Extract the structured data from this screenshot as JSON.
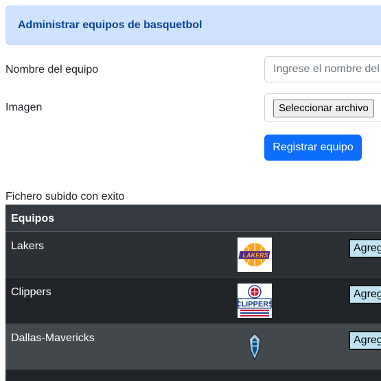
{
  "header": {
    "title": "Administrar equipos de basquetbol"
  },
  "form": {
    "name_label": "Nombre del equipo",
    "name_placeholder": "Ingrese el nombre del equipo",
    "name_value": "",
    "image_label": "Imagen",
    "file_button_label": "Seleccionar archivo",
    "submit_label": "Registrar equipo"
  },
  "status": {
    "message": "Fichero subido con exito"
  },
  "table": {
    "header": "Equipos",
    "rows": [
      {
        "name": "Lakers",
        "logo_icon": "lakers-logo-icon",
        "action_label": "Agregar"
      },
      {
        "name": "Clippers",
        "logo_icon": "clippers-logo-icon",
        "action_label": "Agregar"
      },
      {
        "name": "Dallas-Mavericks",
        "logo_icon": "mavericks-logo-icon",
        "action_label": "Agregar"
      }
    ]
  },
  "colors": {
    "primary": "#0d6efd",
    "alert_bg": "#cfe2ff",
    "alert_text": "#084298",
    "table_dark": "#212529",
    "table_head": "#343a40",
    "action_bg": "#bfe3f1"
  }
}
